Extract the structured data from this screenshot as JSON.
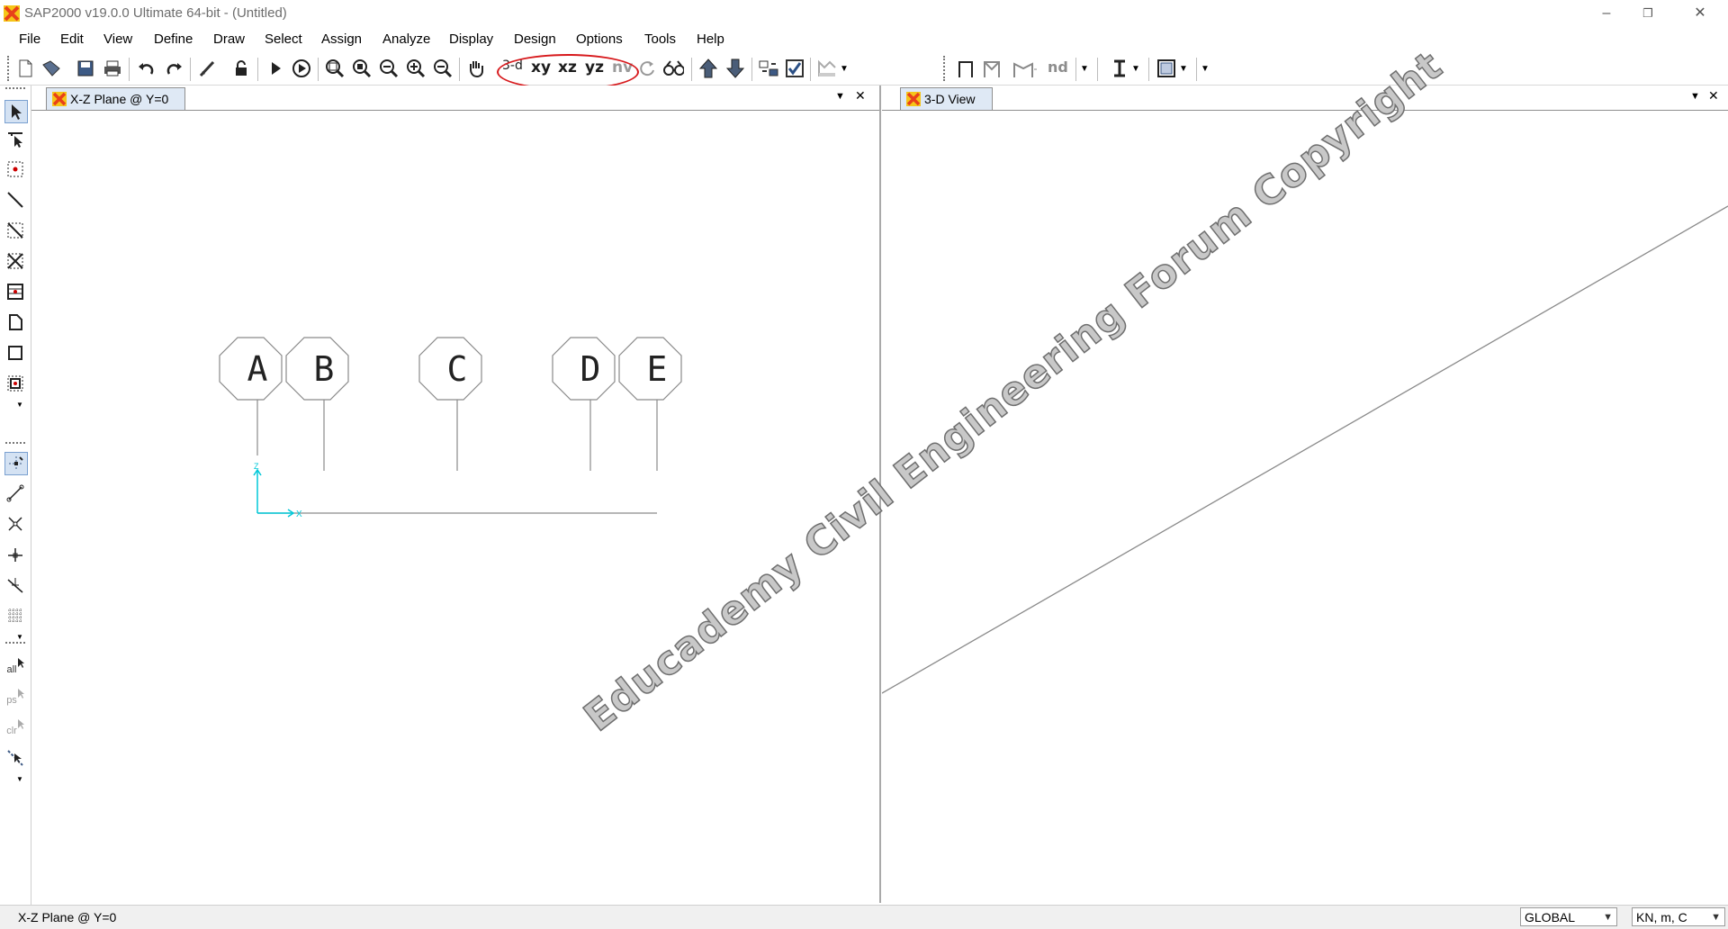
{
  "window": {
    "title": "SAP2000 v19.0.0 Ultimate 64-bit - (Untitled)",
    "controls": [
      "–",
      "❐",
      "✕"
    ]
  },
  "menu": [
    "File",
    "Edit",
    "View",
    "Define",
    "Draw",
    "Select",
    "Assign",
    "Analyze",
    "Display",
    "Design",
    "Options",
    "Tools",
    "Help"
  ],
  "toolbar": {
    "view_3d": "3-d",
    "view_xy": "xy",
    "view_xz": "xz",
    "view_yz": "yz",
    "view_nv": "nv",
    "nd": "nd"
  },
  "left_strip": {
    "all": "all",
    "ps": "ps",
    "clr": "clr"
  },
  "panes": {
    "left": {
      "tab": "X-Z Plane @ Y=0",
      "dropdown": "▼",
      "close": "✕",
      "grid_labels": [
        "A",
        "B",
        "C",
        "D",
        "E"
      ],
      "axis_z": "Z",
      "axis_x": "X"
    },
    "right": {
      "tab": "3-D View",
      "dropdown": "▼",
      "close": "✕"
    }
  },
  "watermark": "Educademy Civil Engineering Forum Copyright",
  "status": {
    "text": "X-Z Plane @ Y=0",
    "coord_system": "GLOBAL",
    "units": "KN, m, C"
  },
  "colors": {
    "axis": "#00c8d8",
    "grid": "#808080",
    "highlight": "#d7191c",
    "app_icon": "#e8401a"
  }
}
